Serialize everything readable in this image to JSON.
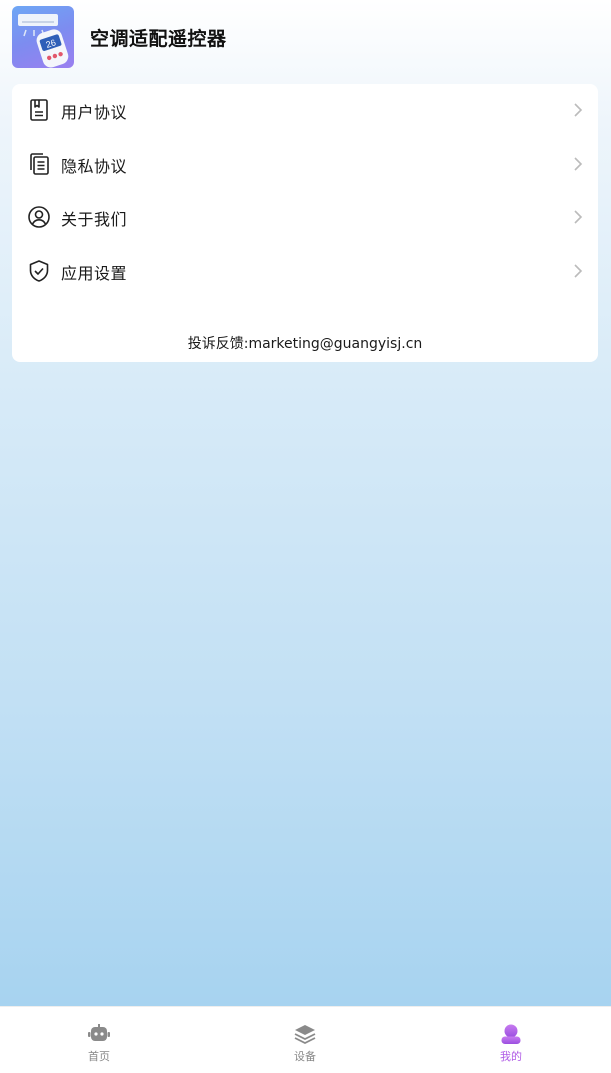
{
  "app": {
    "title": "空调适配遥控器",
    "icon_name": "air-conditioner-remote-app-icon"
  },
  "menu": {
    "items": [
      {
        "label": "用户协议",
        "icon": "user-agreement-icon"
      },
      {
        "label": "隐私协议",
        "icon": "privacy-document-icon"
      },
      {
        "label": "关于我们",
        "icon": "user-circle-icon"
      },
      {
        "label": "应用设置",
        "icon": "shield-check-icon"
      }
    ]
  },
  "feedback": {
    "text": "投诉反馈:marketing@guangyisj.cn"
  },
  "tabbar": {
    "tabs": [
      {
        "label": "首页",
        "icon": "robot-icon",
        "active": false
      },
      {
        "label": "设备",
        "icon": "layers-icon",
        "active": false
      },
      {
        "label": "我的",
        "icon": "user-icon",
        "active": true
      }
    ]
  },
  "colors": {
    "accent": "#b05ce6",
    "inactive": "#888888",
    "card": "#ffffff"
  }
}
